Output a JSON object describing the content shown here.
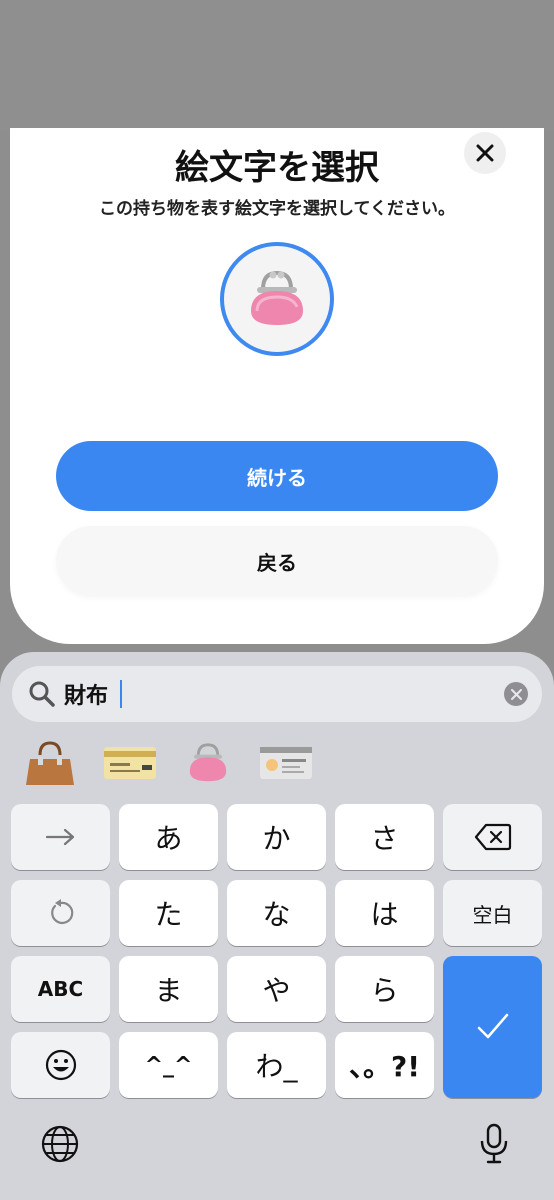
{
  "dialog": {
    "title": "絵文字を選択",
    "subtitle": "この持ち物を表す絵文字を選択してください。",
    "selected_emoji": "purse-emoji",
    "primary_label": "続ける",
    "secondary_label": "戻る"
  },
  "search": {
    "query": "財布"
  },
  "suggestions": [
    {
      "name": "handbag-emoji"
    },
    {
      "name": "credit-card-emoji"
    },
    {
      "name": "purse-emoji"
    },
    {
      "name": "id-card-emoji"
    }
  ],
  "keyboard": {
    "rows": [
      [
        "→",
        "あ",
        "か",
        "さ",
        "⌫"
      ],
      [
        "↺",
        "た",
        "な",
        "は",
        "空白"
      ],
      [
        "ABC",
        "ま",
        "や",
        "ら",
        "✓"
      ],
      [
        "☺",
        "^_^",
        "わ_",
        "、。?!",
        ""
      ]
    ]
  },
  "colors": {
    "accent": "#3b87f2",
    "sheet": "#ffffff",
    "keyboard_bg": "#d2d4d9"
  }
}
